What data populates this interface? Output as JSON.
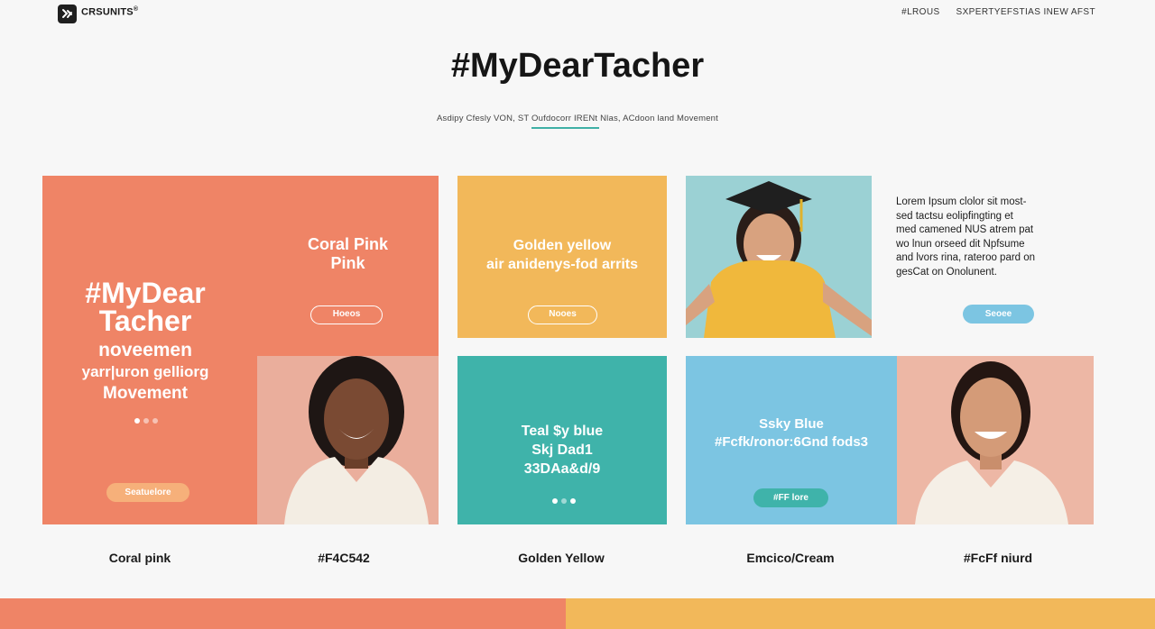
{
  "header": {
    "logo_text": "CRSUNITS",
    "logo_mark": "®",
    "nav": [
      "#LROUS",
      "SXPERTYEFSTIAS INEW AFST"
    ]
  },
  "hero": {
    "title": "#MyDearTacher",
    "subtitle": "Asdipy Cfesly VON, ST Oufdocorr IRENt Nlas, ACdoon land Movement"
  },
  "coral_panel": {
    "card_title_line1": "Coral Pink",
    "card_title_line2": "Pink",
    "card_button": "Hoeos",
    "heading_line1": "#MyDear",
    "heading_line2": "Tacher",
    "line1": "noveemen",
    "line2": "yarr|uron gelliorg",
    "line3": "Movement",
    "cta": "Seatuelore"
  },
  "golden_panel": {
    "title": "Golden yellow",
    "subtitle": "air anidenys-fod arrits",
    "button": "Nooes"
  },
  "info_panel": {
    "lorem": [
      "Lorem Ipsum clolor sit most-",
      "sed tactsu eolipfingting et",
      "med camened NUS atrem pat",
      "wo lnun orseed dit Npfsume",
      "and lvors rina, rateroo pard on",
      "gesCat on Onolunent."
    ],
    "button": "Seoee"
  },
  "teal_panel": {
    "line1": "Teal $y blue",
    "line2": "Skj Dad1",
    "line3": "33DAa&d/9"
  },
  "sky_panel": {
    "line1": "Ssky Blue",
    "line2": "#Fcfk/ronor:6Gnd fods3",
    "button": "#FF lore"
  },
  "swatches": [
    "Coral  pink",
    "#F4C542",
    "Golden Yellow",
    "Emcico/Cream",
    "#FcFf niurd"
  ],
  "colors": {
    "coral": "#ef8466",
    "golden": "#f2b85a",
    "teal": "#3fb3aa",
    "sky": "#7cc5e2",
    "peach": "#edb7a5"
  },
  "icons": [
    "logo-mark-icon"
  ]
}
